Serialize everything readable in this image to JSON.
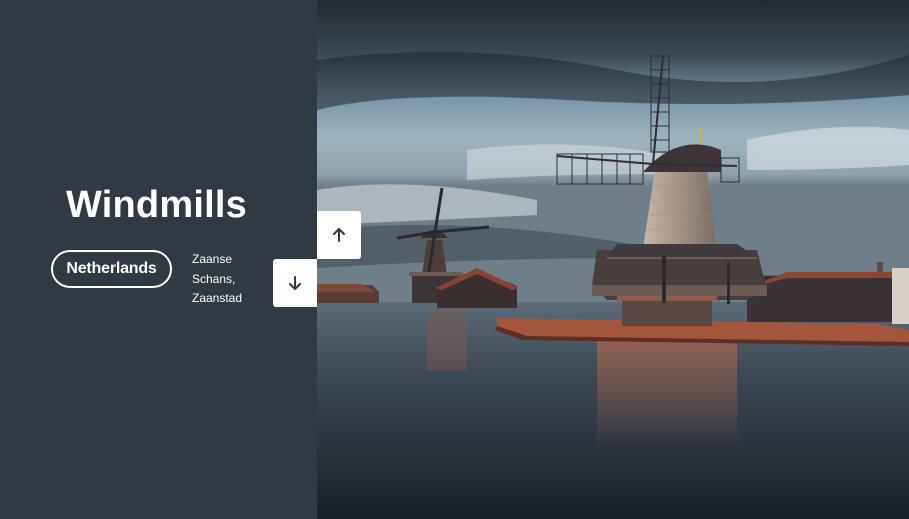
{
  "slide": {
    "title": "Windmills",
    "country": "Netherlands",
    "location": [
      "Zaanse",
      "Schans,",
      "Zaanstad"
    ]
  },
  "nav": {
    "up_icon": "arrow-up-icon",
    "down_icon": "arrow-down-icon"
  },
  "photo": {
    "subject": "windmills-photo"
  },
  "colors": {
    "panel": "#2f3a44",
    "text": "#ffffff",
    "button": "#ffffff",
    "icon": "#2f3a44"
  }
}
